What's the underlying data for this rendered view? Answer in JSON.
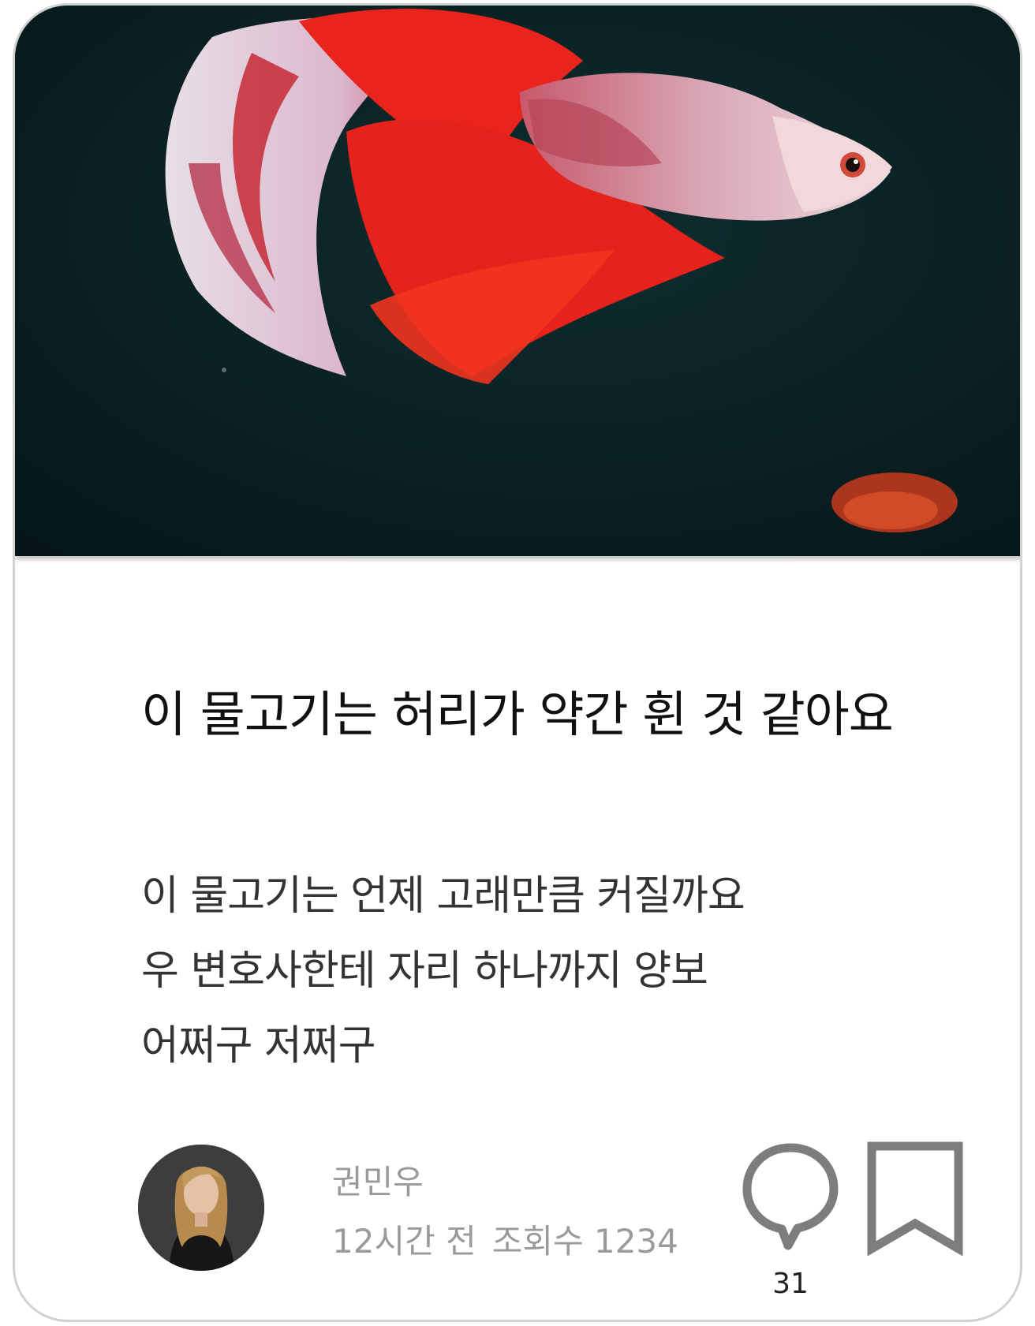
{
  "post": {
    "image_alt": "red and white betta fish",
    "title": "이 물고기는 허리가 약간 휜 것 같아요",
    "body_lines": [
      "이 물고기는 언제 고래만큼 커질까요",
      "우 변호사한테 자리 하나까지 양보",
      "어쩌구 저쩌구"
    ],
    "author": "권민우",
    "time_ago": "12시간 전",
    "views": "조회수 1234",
    "comment_count": "31"
  },
  "icons": {
    "comment": "speech-bubble-icon",
    "bookmark": "bookmark-icon"
  },
  "colors": {
    "card_border": "#d2d2d2",
    "icon_gray": "#7d7d7d",
    "meta_text": "#9a9a9a",
    "image_background": "#0b2224",
    "fish_red": "#e8241c"
  }
}
